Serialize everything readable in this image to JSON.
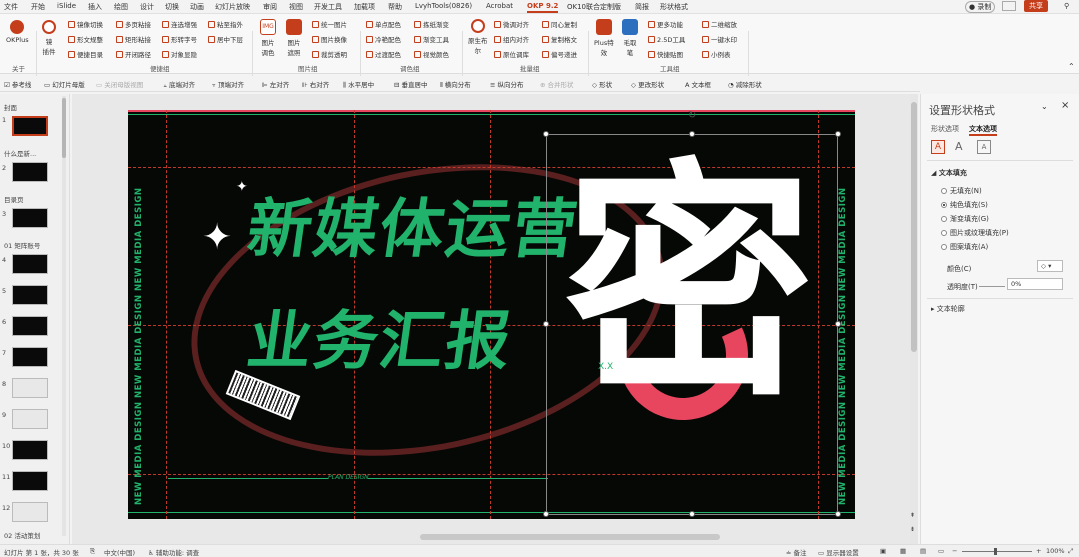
{
  "tabs": [
    "文件",
    "开始",
    "iSlide",
    "插入",
    "绘图",
    "设计",
    "切换",
    "动画",
    "幻灯片放映",
    "审阅",
    "视图",
    "开发工具",
    "加载项",
    "帮助",
    "LvyhTools(0826)",
    "Acrobat",
    "OKP 9.2",
    "OK10联合定制版",
    "简报",
    "形状格式"
  ],
  "title_right": {
    "record": "录制",
    "share": "共享"
  },
  "ribbon": {
    "okplus": "OKPlus",
    "about": "关于",
    "lens_label": "镜\n插件",
    "groups": [
      "关于",
      "便捷组",
      "图片组",
      "调色组",
      "批量组",
      "工具组"
    ],
    "col1": [
      "镜像切换",
      "形文规整",
      "便捷目录"
    ],
    "col2": [
      "多页粘接",
      "矩形粘接",
      "开闭路径"
    ],
    "col3": [
      "连选增强",
      "形转字号",
      "对象显隐"
    ],
    "col4": [
      "粘至指外",
      "居中下层"
    ],
    "img": [
      "图片\n调色",
      "图片\n遮照"
    ],
    "col5": [
      "统一图片",
      "图片换像",
      "裁剪透明"
    ],
    "col6": [
      "单点配色",
      "冷艳配色",
      "过渡配色"
    ],
    "col7": [
      "拣纸渐变",
      "渐变工具",
      "视觉颜色"
    ],
    "orig": "原生布\n尔",
    "col8": [
      "微调对齐",
      "组内对齐",
      "原位调库"
    ],
    "col9": [
      "同心复制",
      "复制格文",
      "偏号递进"
    ],
    "plus": "Plus特\n效",
    "brush": "毛取\n笔",
    "col10": [
      "更多功能",
      "2.5D工具",
      "快捷贴图"
    ],
    "col11": [
      "二维缩放",
      "一键水印",
      "小例表"
    ]
  },
  "toolbar2": [
    "参考线",
    "幻灯片母版",
    "关闭母版视图",
    "底端对齐",
    "顶端对齐",
    "左对齐",
    "右对齐",
    "水平居中",
    "垂直居中",
    "横向分布",
    "纵向分布",
    "合并形状",
    "形状",
    "更改形状",
    "文本框",
    "减除形状"
  ],
  "thumbs": {
    "sections": [
      "封面",
      "什么是新...",
      "目录页",
      "01 矩阵账号",
      "02 活动策划"
    ],
    "numbers": [
      "1",
      "2",
      "3",
      "4",
      "5",
      "6",
      "7",
      "8",
      "9",
      "10",
      "11",
      "12"
    ]
  },
  "slide": {
    "headline1": "新媒体运营",
    "headline2": "业务汇报",
    "side_text": "NEW MEDIA DESIGN NEW MEDIA DESIGN NEW MEDIA DESIGN",
    "plan": "PLAN DESIGN",
    "big_char": "密",
    "xx": "X.X"
  },
  "pane": {
    "title": "设置形状格式",
    "tab_shape": "形状选项",
    "tab_text": "文本选项",
    "section_fill": "文本填充",
    "options": [
      "无填充(N)",
      "纯色填充(S)",
      "渐变填充(G)",
      "图片或纹理填充(P)",
      "图案填充(A)"
    ],
    "selected_option": 1,
    "color_label": "颜色(C)",
    "transparency_label": "透明度(T)",
    "transparency_value": "0%",
    "section_outline": "文本轮廓"
  },
  "status": {
    "slide_info": "幻灯片 第 1 张，共 30 张",
    "lang": "中文(中国)",
    "access": "辅助功能: 调查",
    "notes": "备注",
    "display": "显示器设置",
    "zoom": "100%"
  },
  "colors": {
    "accent": "#c43e1c",
    "green": "#21b36b",
    "pink": "#e8455e"
  }
}
